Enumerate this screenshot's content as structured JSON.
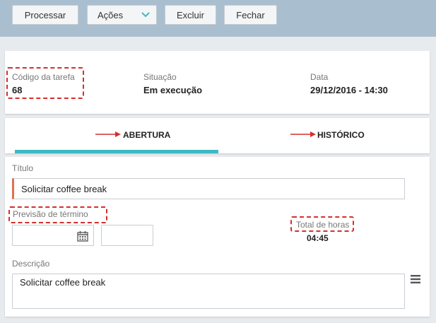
{
  "toolbar": {
    "processar": "Processar",
    "acoes": "Ações",
    "excluir": "Excluir",
    "fechar": "Fechar"
  },
  "summary": {
    "codigo_label": "Código da tarefa",
    "codigo_value": "68",
    "situacao_label": "Situação",
    "situacao_value": "Em execução",
    "data_label": "Data",
    "data_value": "29/12/2016 - 14:30"
  },
  "tabs": {
    "abertura": "ABERTURA",
    "historico": "HISTÓRICO",
    "active": "abertura"
  },
  "form": {
    "titulo_label": "Título",
    "titulo_value": "Solicitar coffee break",
    "previsao_label": "Previsão de término",
    "previsao_date": "",
    "previsao_time": "",
    "total_label": "Total de horas",
    "total_value": "04:45",
    "descricao_label": "Descrição",
    "descricao_value": "Solicitar coffee break"
  },
  "colors": {
    "toolbar_bg": "#a9bfcf",
    "tab_active": "#3fb9c4",
    "highlight": "#d32f2f",
    "required_marker": "#e07050"
  }
}
